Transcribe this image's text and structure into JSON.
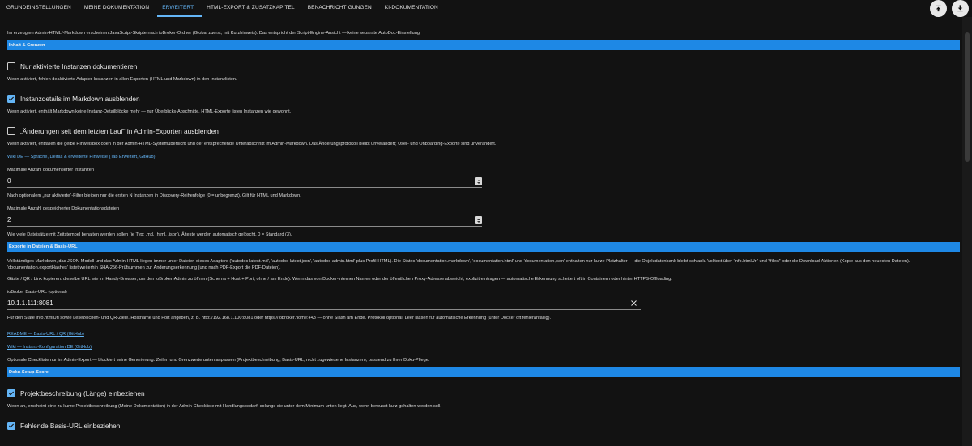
{
  "tabs": [
    {
      "label": "GRUNDEINSTELLUNGEN"
    },
    {
      "label": "MEINE DOKUMENTATION"
    },
    {
      "label": "ERWEITERT"
    },
    {
      "label": "HTML-EXPORT & ZUSATZKAPITEL"
    },
    {
      "label": "BENACHRICHTIGUNGEN"
    },
    {
      "label": "KI-DOKUMENTATION"
    }
  ],
  "active_tab": "ERWEITERT",
  "colors": {
    "accent": "#64b5f6",
    "section": "#1e88e5",
    "background": "#121212"
  },
  "intro": "Im erzeugten Admin-HTML/-Markdown erscheinen JavaScript-Skripte nach ioBroker-Ordner (Global zuerst, mit Kurzhinweis). Das entspricht der Script-Engine-Ansicht — keine separate AutoDoc-Einstellung.",
  "section1": {
    "title": "Inhalt & Grenzen",
    "cb1": {
      "label": "Nur aktivierte Instanzen dokumentieren",
      "checked": false,
      "help": "Wenn aktiviert, fehlen deaktivierte Adapter-Instanzen in allen Exporten (HTML und Markdown) in den Instanzlisten."
    },
    "cb2": {
      "label": "Instanzdetails im Markdown ausblenden",
      "checked": true,
      "help": "Wenn aktiviert, enthält Markdown keine Instanz-Detailblöcke mehr — nur Überblicks-Abschnitte. HTML-Exporte listen Instanzen wie gewohnt."
    },
    "cb3": {
      "label": "„Änderungen seit dem letzten Lauf“ in Admin-Exporten ausblenden",
      "checked": false,
      "help": "Wenn aktiviert, entfallen die gelbe Hinweisbox oben in der Admin-HTML-Systemübersicht und der entsprechende Unterabschnitt im Admin-Markdown. Das Änderungsprotokoll bleibt unverändert; User- und Onboarding-Exporte sind unverändert."
    },
    "link": "Wiki DE — Sprache, Deltas & erweiterte Hinweise (Tab Erweitert, GitHub)",
    "max_instances": {
      "label": "Maximale Anzahl dokumentierter Instanzen",
      "value": "0",
      "help": "Nach optionalem „nur aktivierte“-Filter bleiben nur die ersten N Instanzen in Discovery-Reihenfolge (0 = unbegrenzt). Gilt für HTML und Markdown."
    },
    "max_files": {
      "label": "Maximale Anzahl gespeicherter Dokumentationsdateien",
      "value": "2",
      "help": "Wie viele Dateisätze mit Zeitstempel behalten werden sollen (je Typ: .md, .html, .json). Älteste werden automatisch gelöscht. 0 = Standard (3)."
    }
  },
  "section2": {
    "title": "Exporte in Dateien & Basis-URL",
    "p1": "Vollständiges Markdown, das JSON-Modell und das Admin-HTML liegen immer unter Dateien dieses Adapters ('autodoc-latest.md', 'autodoc-latest.json', 'autodoc-admin.html' plus Profil-HTML). Die States 'documentation.markdown', 'documentation.html' und 'documentation.json' enthalten nur kurze Platzhalter — die Objektdatenbank bleibt schlank. Volltext über 'info.htmlUrl' und '/files/' oder die Download-Aktionen (Kopie aus den neuesten Dateien). 'documentation.exportHashes' listet weiterhin SHA-256-Prüfsummen zur Änderungserkennung (und nach PDF-Export die PDF-Dateien).",
    "p2": "Gäste / QR / Link kopieren: dieselbe URL wie im Handy-Browser, um den ioBroker-Admin zu öffnen (Schema + Host + Port, ohne / am Ende). Wenn das von Docker-internen Namen oder der öffentlichen Proxy-Adresse abweicht, explizit eintragen — automatische Erkennung scheitert oft in Containern oder hinter HTTPS-Offloading.",
    "base_url": {
      "label": "ioBroker Basis-URL (optional)",
      "value": "10.1.1.111:8081",
      "help": "Für den State info.htmlUrl sowie Lesezeichen- und QR-Ziele. Hostname und Port angeben, z. B. http://192.168.1.100:8081 oder https://iobroker.home:443 — ohne Slash am Ende. Protokoll optional. Leer lassen für automatische Erkennung (unter Docker oft fehleranfällig)."
    },
    "link1": "README — Basis-URL / QR (GitHub)",
    "link2": "Wiki — Instanz-Konfiguration DE (GitHub)",
    "p3": "Optionale Checkliste nur im Admin-Export — blockiert keine Generierung. Zeilen und Grenzwerte unten anpassen (Projektbeschreibung, Basis-URL, nicht zugewiesene Instanzen), passend zu Ihrer Doku-Pflege."
  },
  "section3": {
    "title": "Doku-Setup-Score",
    "cb1": {
      "label": "Projektbeschreibung (Länge) einbeziehen",
      "checked": true,
      "help": "Wenn an, erscheint eine zu kurze Projektbeschreibung (Meine Dokumentation) in der Admin-Checkliste mit Handlungsbedarf, solange sie unter dem Minimum unten liegt. Aus, wenn bewusst kurz gehalten werden soll."
    },
    "cb2": {
      "label": "Fehlende Basis-URL einbeziehen",
      "checked": true
    }
  }
}
